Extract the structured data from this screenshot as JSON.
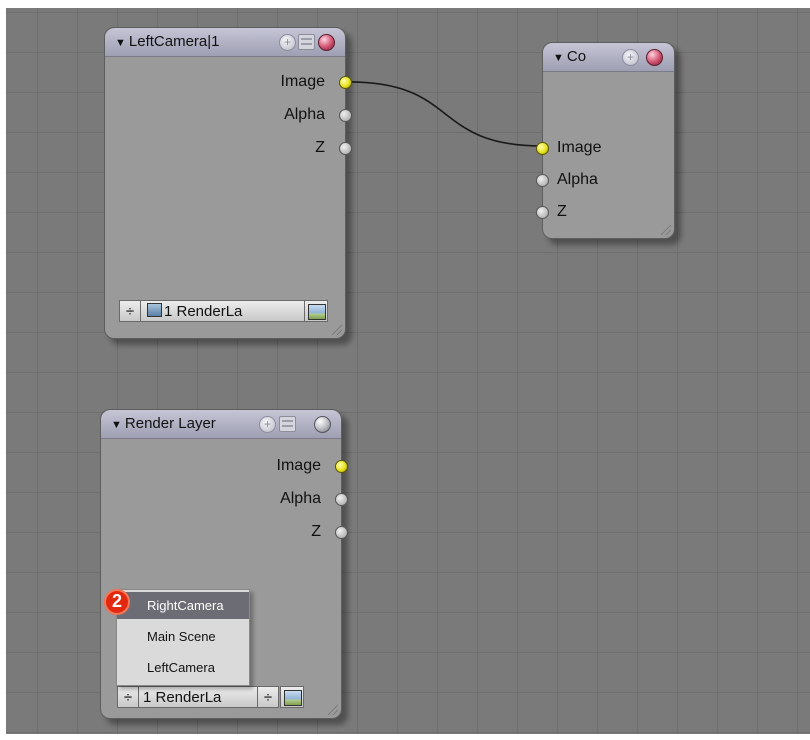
{
  "nodes": {
    "left_camera": {
      "title": "LeftCamera|1",
      "outputs": [
        "Image",
        "Alpha",
        "Z"
      ],
      "layer_button": "1 RenderLa"
    },
    "composite": {
      "title": "Co",
      "inputs": [
        "Image",
        "Alpha",
        "Z"
      ]
    },
    "render_layer": {
      "title": "Render Layer",
      "outputs": [
        "Image",
        "Alpha",
        "Z"
      ],
      "layer_button": "1 RenderLa"
    }
  },
  "scene_dropdown": {
    "items": [
      "RightCamera",
      "Main Scene",
      "LeftCamera"
    ],
    "highlighted": "RightCamera"
  },
  "callout": {
    "number": "2",
    "color": "#e2290f"
  },
  "colors": {
    "image_socket": "#e7e21e",
    "canvas": "#7a7a7a"
  }
}
